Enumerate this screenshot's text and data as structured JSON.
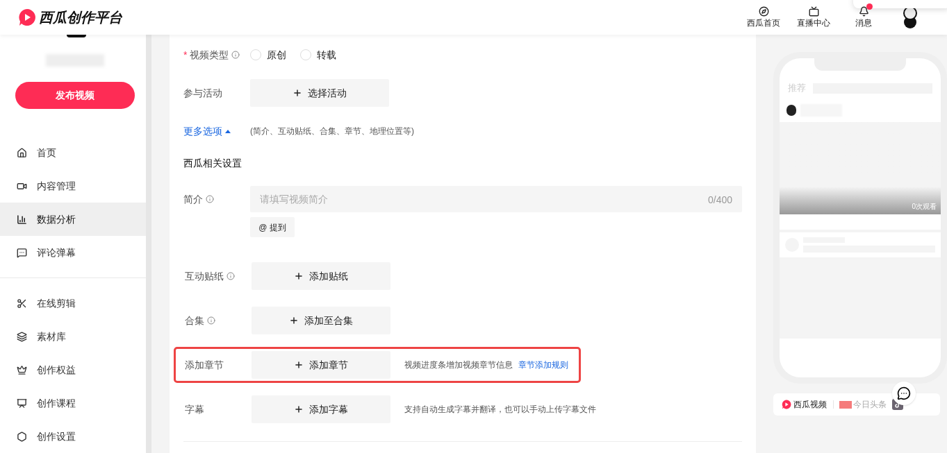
{
  "header": {
    "logo_text": "西瓜创作平台",
    "nav": [
      {
        "kind": "home",
        "label": "西瓜首页"
      },
      {
        "kind": "live",
        "label": "直播中心"
      },
      {
        "kind": "bell",
        "label": "消息",
        "unread": true
      }
    ]
  },
  "sidebar": {
    "publish_button": "发布视频",
    "groups": [
      [
        {
          "label": "首页",
          "selected": false
        },
        {
          "label": "内容管理",
          "selected": false
        },
        {
          "label": "数据分析",
          "selected": true
        },
        {
          "label": "评论弹幕",
          "selected": false
        }
      ],
      [
        {
          "label": "在线剪辑",
          "selected": false
        },
        {
          "label": "素材库",
          "selected": false
        },
        {
          "label": "创作权益",
          "selected": false
        },
        {
          "label": "创作课程",
          "selected": false
        },
        {
          "label": "创作设置",
          "selected": false
        }
      ]
    ]
  },
  "form": {
    "video_type": {
      "label": "视频类型",
      "required_mark": "*",
      "options": [
        {
          "label": "原创",
          "selected": false
        },
        {
          "label": "转载",
          "selected": false
        }
      ]
    },
    "activity": {
      "label": "参与活动",
      "button": "选择活动"
    },
    "more_options": {
      "label": "更多选项",
      "hint": "(简介、互动贴纸、合集、章节、地理位置等)",
      "expanded": true
    },
    "section_title": "西瓜相关设置",
    "intro": {
      "label": "简介",
      "placeholder": "请填写视频简介",
      "counter": "0/400",
      "mention_button": "@ 提到"
    },
    "rows": [
      {
        "label": "互动贴纸",
        "info": true,
        "button": "添加贴纸",
        "highlighted": false
      },
      {
        "label": "合集",
        "info": true,
        "button": "添加至合集",
        "highlighted": false
      },
      {
        "label": "添加章节",
        "info": false,
        "button": "添加章节",
        "hint": "视频进度条增加视频章节信息",
        "link": "章节添加规则",
        "highlighted": true
      },
      {
        "label": "字幕",
        "info": false,
        "button": "添加字幕",
        "hint": "支持自动生成字幕并翻译，也可以手动上传字幕文件",
        "highlighted": false
      }
    ]
  },
  "preview": {
    "tab": "推荐",
    "views": "0次观看",
    "platforms": [
      {
        "kind": "xigua",
        "name": "西瓜视频"
      },
      {
        "kind": "toutiao",
        "name": "今日头条"
      },
      {
        "kind": "douyin"
      }
    ]
  }
}
